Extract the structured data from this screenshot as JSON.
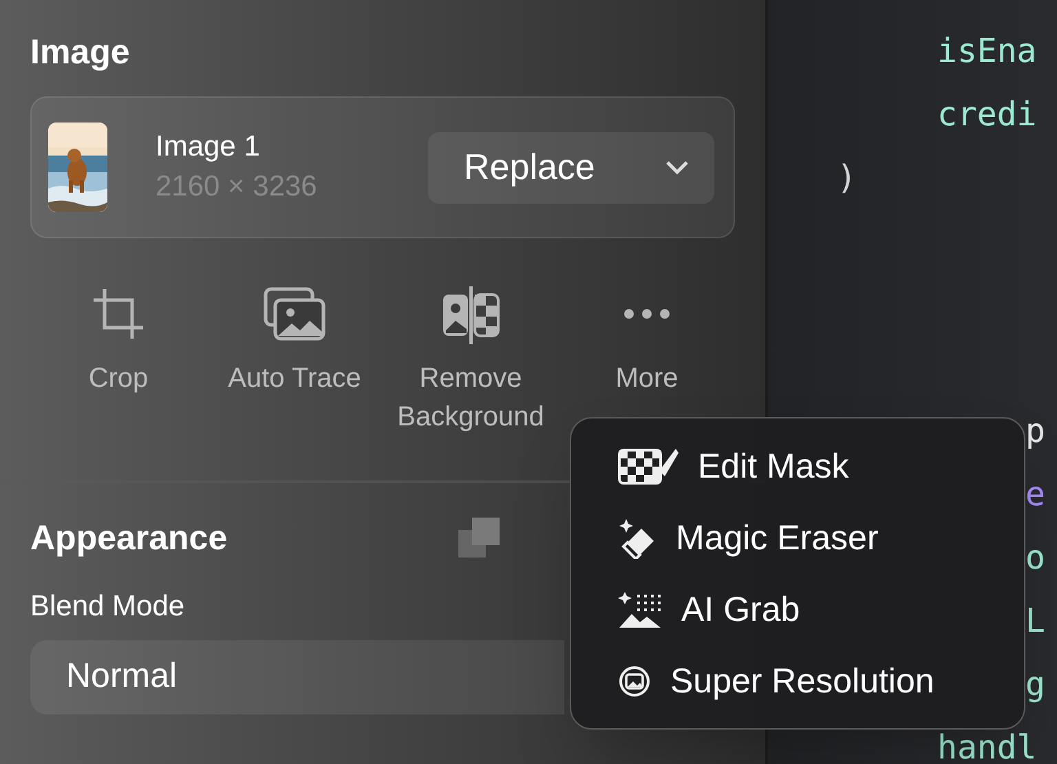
{
  "inspector": {
    "section_title": "Image",
    "image": {
      "kind": "picture",
      "name": "Image 1",
      "dimensions": "2160 × 3236",
      "replace_button": "Replace"
    },
    "actions": [
      {
        "label": "Crop",
        "kind": "crop"
      },
      {
        "label": "Auto Trace",
        "kind": "trace"
      },
      {
        "label": "Remove Background",
        "kind": "remove-bg"
      },
      {
        "label": "More",
        "kind": "more"
      }
    ],
    "appearance": {
      "title": "Appearance",
      "blend_mode_label": "Blend Mode",
      "blend_mode_value": "Normal"
    }
  },
  "code": {
    "lines": [
      {
        "text": "isEna",
        "kind": "member",
        "color": "#9de8d0"
      },
      {
        "text": "credi",
        "kind": "member",
        "color": "#9de8d0"
      },
      {
        "text": ")",
        "kind": "close",
        "color": "#d4d4d4"
      },
      {
        "kind": "blank"
      },
      {
        "kind": "blank"
      },
      {
        "kind": "blank"
      },
      {
        "text": "p",
        "kind": "fragment",
        "color": "#e5e5e5"
      },
      {
        "text": "e",
        "kind": "fragment",
        "color": "#a78bfa"
      },
      {
        "text": "o",
        "kind": "fragment",
        "color": "#9de8d0"
      },
      {
        "text": "L",
        "kind": "fragment",
        "color": "#9de8d0"
      },
      {
        "text": "g",
        "kind": "fragment",
        "color": "#9de8d0"
      },
      {
        "text": "handl",
        "kind": "member",
        "color": "#9de8d0"
      }
    ]
  },
  "more_menu": {
    "items": [
      {
        "label": "Edit Mask",
        "kind": "mask"
      },
      {
        "label": "Magic Eraser",
        "kind": "eraser"
      },
      {
        "label": "AI Grab",
        "kind": "grab"
      },
      {
        "label": "Super Resolution",
        "kind": "super"
      }
    ]
  }
}
